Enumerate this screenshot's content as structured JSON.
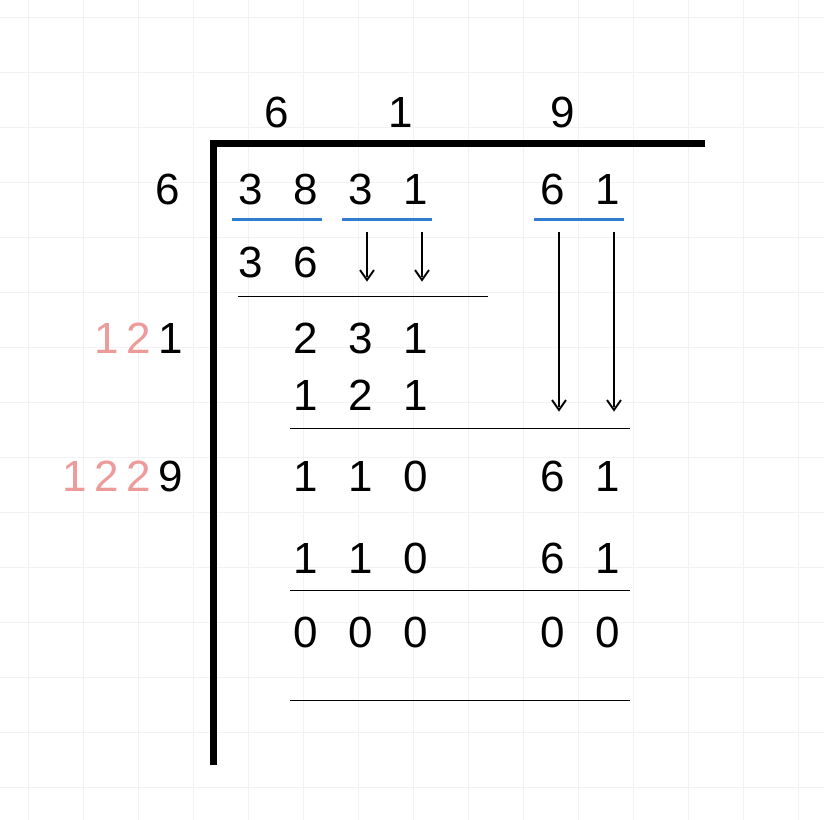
{
  "problem": {
    "kind": "square-root-long-division",
    "radicand": "383161",
    "result": "619"
  },
  "quotient": {
    "d1": "6",
    "d2": "1",
    "d3": "9"
  },
  "divisor_start": "6",
  "radicand_groups": {
    "g1a": "3",
    "g1b": "8",
    "g2a": "3",
    "g2b": "1",
    "g3a": "6",
    "g3b": "1"
  },
  "step1_product": {
    "a": "3",
    "b": "6"
  },
  "side1": {
    "p1": "1",
    "p2": "2",
    "p3": "1"
  },
  "step2_diff": {
    "a": "2",
    "b": "3",
    "c": "1"
  },
  "step2_product": {
    "a": "1",
    "b": "2",
    "c": "1"
  },
  "side2": {
    "p1": "1",
    "p2": "2",
    "p3": "2",
    "p4": "9"
  },
  "step3_diff": {
    "a": "1",
    "b": "1",
    "c": "0",
    "d": "6",
    "e": "1"
  },
  "step3_product": {
    "a": "1",
    "b": "1",
    "c": "0",
    "d": "6",
    "e": "1"
  },
  "final": {
    "a": "0",
    "b": "0",
    "c": "0",
    "d": "0",
    "e": "0"
  }
}
